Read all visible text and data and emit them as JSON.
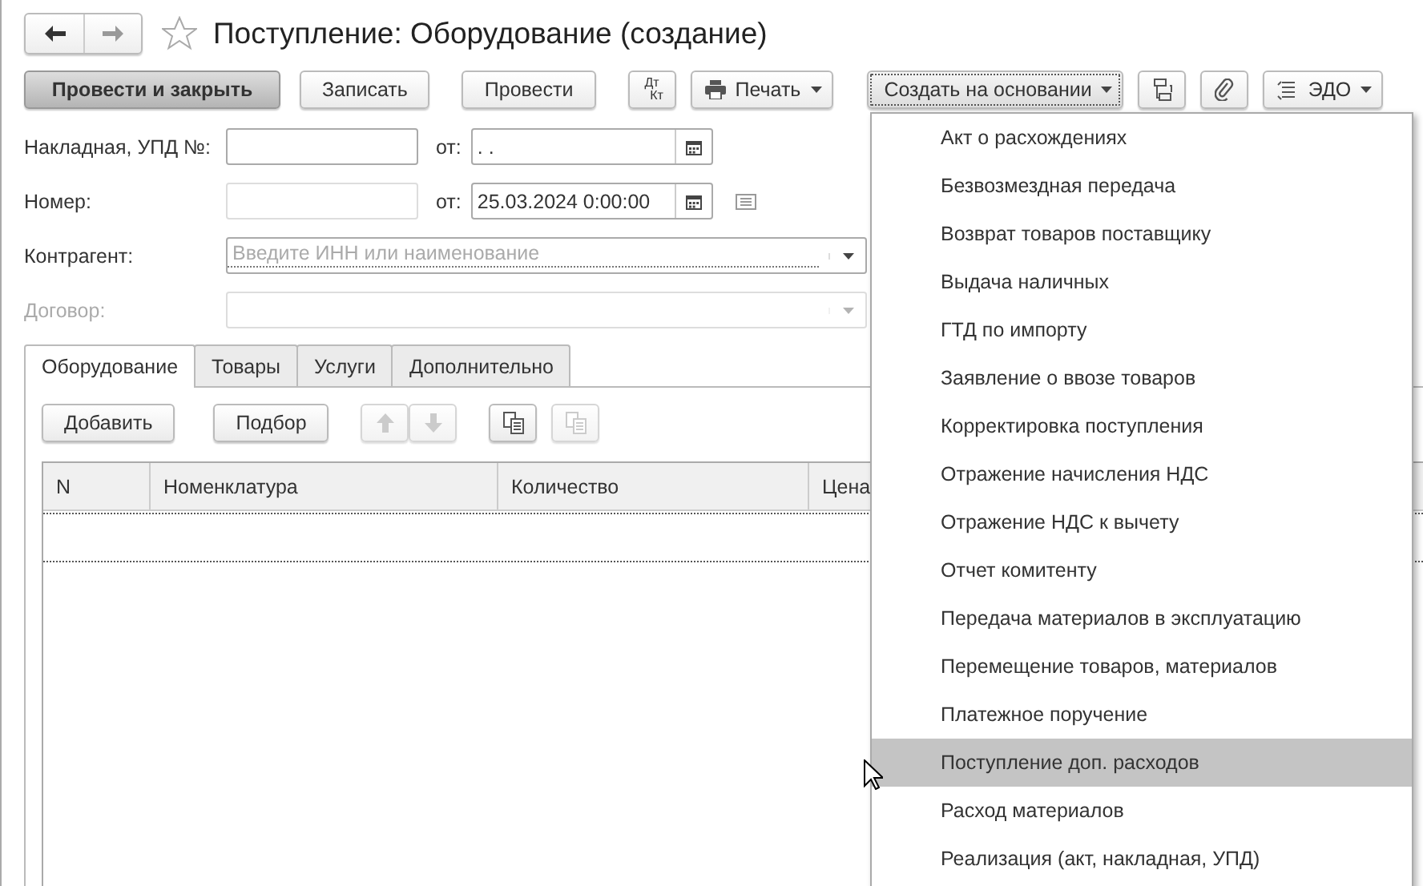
{
  "window": {
    "title": "Поступление: Оборудование (создание)",
    "favorite": false
  },
  "toolbar": {
    "buttons": [
      {
        "kind": "primary",
        "label": "Провести и закрыть"
      },
      {
        "kind": "plain",
        "label": "Записать"
      },
      {
        "kind": "plain",
        "label": "Провести"
      },
      {
        "kind": "dtkt",
        "label_top": "Дт",
        "label_bottom": "Кт"
      },
      {
        "kind": "print",
        "label": "Печать"
      },
      {
        "kind": "menu",
        "label": "Создать на основании",
        "expanded": true
      },
      {
        "kind": "structure"
      },
      {
        "kind": "attach"
      },
      {
        "kind": "edo",
        "label": "ЭДО"
      }
    ]
  },
  "form": {
    "rows": [
      {
        "label": "Накладная, УПД №:",
        "value": "",
        "disabled": false,
        "date_label": "от:",
        "date_value": ". .",
        "kind": "number_date"
      },
      {
        "label": "Номер:",
        "value": "",
        "disabled": true,
        "date_label": "от:",
        "date_value": "25.03.2024  0:00:00",
        "kind": "number_date"
      },
      {
        "label": "Контрагент:",
        "placeholder": "Введите ИНН или наименование",
        "disabled": false,
        "kind": "reference"
      },
      {
        "label": "Договор:",
        "disabled": true,
        "kind": "reference"
      }
    ]
  },
  "tabs": [
    {
      "label": "Оборудование",
      "selected": true
    },
    {
      "label": "Товары",
      "selected": false
    },
    {
      "label": "Услуги",
      "selected": false
    },
    {
      "label": "Дополнительно",
      "selected": false
    }
  ],
  "table_toolbar": {
    "buttons": [
      {
        "kind": "text",
        "label": "Добавить",
        "disabled": false
      },
      {
        "kind": "text",
        "label": "Подбор",
        "disabled": false
      },
      {
        "kind": "up",
        "disabled": true
      },
      {
        "kind": "down",
        "disabled": true
      },
      {
        "kind": "copy",
        "disabled": false
      },
      {
        "kind": "paste",
        "disabled": true
      }
    ]
  },
  "table": {
    "columns": [
      "N",
      "Номенклатура",
      "Количество",
      "Цена"
    ]
  },
  "dropdown": {
    "items": [
      {
        "label": "Акт о расхождениях",
        "selected": false
      },
      {
        "label": "Безвозмездная передача",
        "selected": false
      },
      {
        "label": "Возврат товаров поставщику",
        "selected": false
      },
      {
        "label": "Выдача наличных",
        "selected": false
      },
      {
        "label": "ГТД по импорту",
        "selected": false
      },
      {
        "label": "Заявление о ввозе товаров",
        "selected": false
      },
      {
        "label": "Корректировка поступления",
        "selected": false
      },
      {
        "label": "Отражение начисления НДС",
        "selected": false
      },
      {
        "label": "Отражение НДС к вычету",
        "selected": false
      },
      {
        "label": "Отчет комитенту",
        "selected": false
      },
      {
        "label": "Передача материалов в эксплуатацию",
        "selected": false
      },
      {
        "label": "Перемещение товаров, материалов",
        "selected": false
      },
      {
        "label": "Платежное поручение",
        "selected": false
      },
      {
        "label": "Поступление доп. расходов",
        "selected": true
      },
      {
        "label": "Расход материалов",
        "selected": false
      },
      {
        "label": "Реализация (акт, накладная, УПД)",
        "selected": false
      }
    ]
  }
}
